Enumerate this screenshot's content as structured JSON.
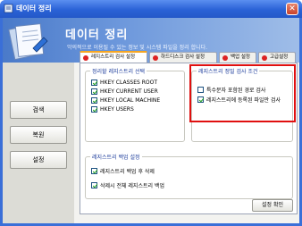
{
  "window": {
    "title": "데이터 정리",
    "close_glyph": "✕"
  },
  "header": {
    "title": "데이터 정리",
    "description": "악의적으로 이용될 수 있는 정보 및 시스템 파일을 정리 합니다."
  },
  "sidebar": {
    "buttons": [
      {
        "label": "검색"
      },
      {
        "label": "복원"
      },
      {
        "label": "설정"
      }
    ]
  },
  "tabs": [
    {
      "label": "레지스트리 검사 설정",
      "active": true
    },
    {
      "label": "하드디스크 검사 설정",
      "active": false
    },
    {
      "label": "백업 설정",
      "active": false
    },
    {
      "label": "고급설정",
      "active": false
    }
  ],
  "registry_group": {
    "title": "정리할 레지스트리 선택",
    "items": [
      {
        "label": "HKEY CLASSES ROOT",
        "checked": true
      },
      {
        "label": "HKEY CURRENT USER",
        "checked": true
      },
      {
        "label": "HKEY LOCAL MACHINE",
        "checked": true
      },
      {
        "label": "HKEY USERS",
        "checked": true
      }
    ]
  },
  "condition_group": {
    "title": "레지스트리 정밀 검사 조건",
    "items": [
      {
        "label": "특수문자 포함된 경로 검사",
        "checked": false
      },
      {
        "label": "레지스트리에 등록된 파일만 검사",
        "checked": true
      }
    ]
  },
  "backup_group": {
    "title": "레지스트리 백업 설정",
    "items": [
      {
        "label": "레지스트리 백업 후 삭제",
        "checked": true
      },
      {
        "label": "삭제시 전체 레지스트리 백업",
        "checked": true
      }
    ]
  },
  "confirm_button": {
    "label": "설정 확인"
  },
  "colors": {
    "accent": "#3a6fd8",
    "highlight": "#e01010",
    "tab_dot": "#dd2222"
  }
}
